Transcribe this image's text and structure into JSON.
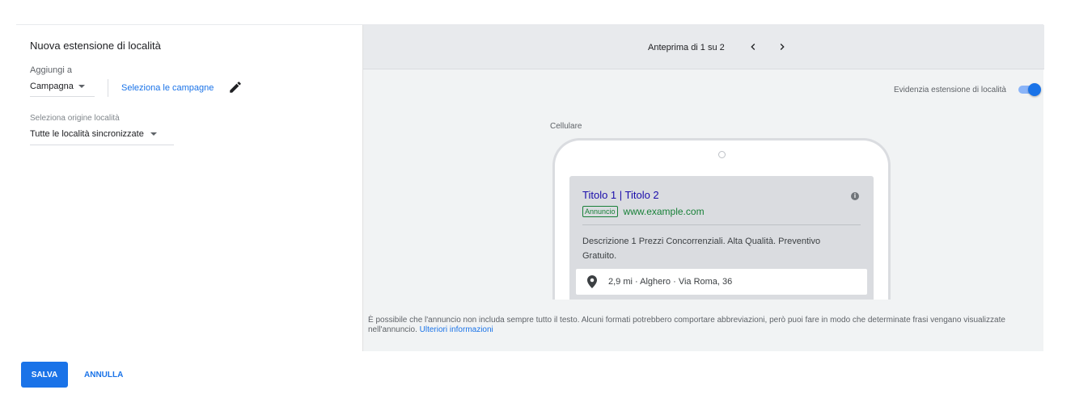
{
  "left": {
    "title": "Nuova estensione di località",
    "add_to_label": "Aggiungi a",
    "add_to_value": "Campagna",
    "select_campaigns_link": "Seleziona le campagne",
    "origin_label": "Seleziona origine località",
    "origin_value": "Tutte le località sincronizzate"
  },
  "preview": {
    "counter": "Anteprima di 1 su 2",
    "highlight_label": "Evidenzia estensione di località",
    "highlight_on": true,
    "device_label": "Cellulare",
    "ad": {
      "title": "Titolo 1 | Titolo 2",
      "badge": "Annuncio",
      "url": "www.example.com",
      "description": "Descrizione 1 Prezzi Concorrenziali. Alta Qualità. Preventivo Gratuito.",
      "location": "2,9 mi · Alghero · Via Roma, 36"
    },
    "disclaimer": "È possibile che l'annuncio non includa sempre tutto il testo. Alcuni formati potrebbero comportare abbreviazioni, però puoi fare in modo che determinate frasi vengano visualizzate nell'annuncio.",
    "learn_more": "Ulteriori informazioni"
  },
  "actions": {
    "save": "SALVA",
    "cancel": "ANNULLA"
  },
  "colors": {
    "accent": "#1a73e8",
    "ad_title": "#1a0dab",
    "ad_url": "#188038"
  },
  "icons": {
    "edit": "pencil-icon",
    "previous": "chevron-left-icon",
    "next": "chevron-right-icon",
    "info": "info-icon",
    "location": "map-pin-icon"
  }
}
